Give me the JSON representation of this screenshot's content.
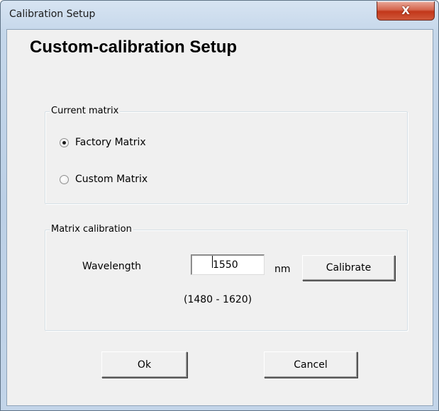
{
  "window": {
    "title": "Calibration Setup",
    "close_icon": "close-icon",
    "close_glyph": "X"
  },
  "heading": "Custom-calibration Setup",
  "current_matrix": {
    "legend": "Current matrix",
    "options": [
      {
        "label": "Factory  Matrix",
        "checked": true
      },
      {
        "label": "Custom Matrix",
        "checked": false
      }
    ]
  },
  "matrix_calibration": {
    "legend": "Matrix calibration",
    "wavelength_label": "Wavelength",
    "wavelength_value": "1550",
    "unit": "nm",
    "range": "(1480 - 1620)",
    "calibrate_label": "Calibrate"
  },
  "buttons": {
    "ok_label": "Ok",
    "cancel_label": "Cancel"
  },
  "colors": {
    "close_button": "#c2371a",
    "frame": "#bcd0e6",
    "client_bg": "#f0f0f0"
  }
}
